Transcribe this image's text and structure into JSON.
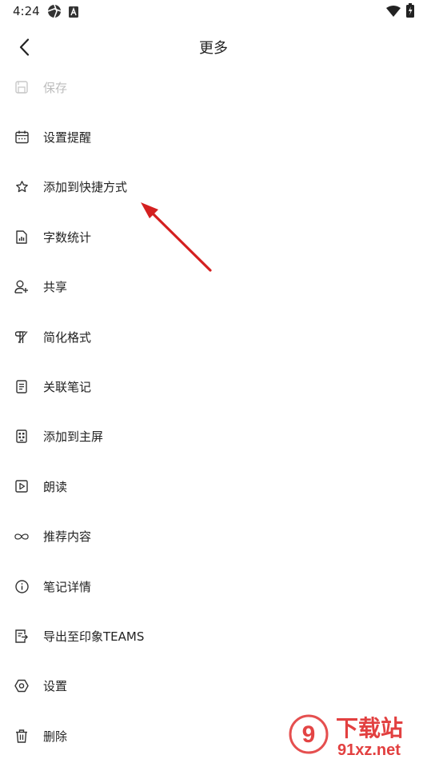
{
  "status_bar": {
    "time": "4:24"
  },
  "header": {
    "title": "更多"
  },
  "menu": {
    "items": [
      {
        "label": "保存",
        "icon": "save-icon",
        "enabled": false
      },
      {
        "label": "设置提醒",
        "icon": "calendar-icon",
        "enabled": true
      },
      {
        "label": "添加到快捷方式",
        "icon": "star-icon",
        "enabled": true
      },
      {
        "label": "字数统计",
        "icon": "word-count-icon",
        "enabled": true
      },
      {
        "label": "共享",
        "icon": "share-person-icon",
        "enabled": true
      },
      {
        "label": "简化格式",
        "icon": "clear-format-icon",
        "enabled": true
      },
      {
        "label": "关联笔记",
        "icon": "linked-note-icon",
        "enabled": true
      },
      {
        "label": "添加到主屏",
        "icon": "home-screen-icon",
        "enabled": true
      },
      {
        "label": "朗读",
        "icon": "play-icon",
        "enabled": true
      },
      {
        "label": "推荐内容",
        "icon": "infinity-icon",
        "enabled": true
      },
      {
        "label": "笔记详情",
        "icon": "info-icon",
        "enabled": true
      },
      {
        "label": "导出至印象TEAMS",
        "icon": "export-icon",
        "enabled": true
      },
      {
        "label": "设置",
        "icon": "settings-icon",
        "enabled": true
      },
      {
        "label": "删除",
        "icon": "trash-icon",
        "enabled": true
      }
    ]
  },
  "watermark": {
    "text_main": "下载站",
    "text_url": "91xz.net"
  },
  "colors": {
    "annotation_arrow": "#d42020",
    "disabled_text": "#bdbdbd",
    "text": "#222222",
    "watermark_red": "#e03030"
  }
}
